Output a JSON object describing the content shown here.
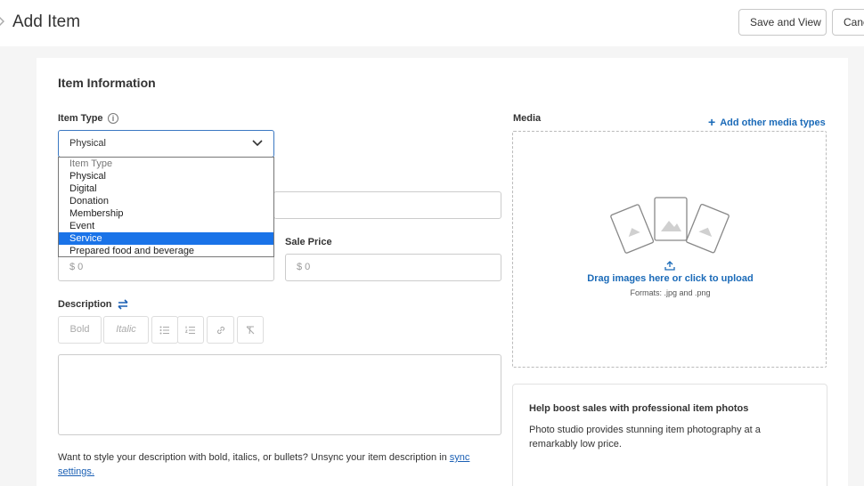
{
  "header": {
    "title": "Add Item",
    "save_view_label": "Save and View",
    "cancel_label": "Canc"
  },
  "item_info": {
    "section_title": "Item Information",
    "item_type_label": "Item Type",
    "item_type_value": "Physical",
    "options": [
      "Item Type",
      "Physical",
      "Digital",
      "Donation",
      "Membership",
      "Event",
      "Service",
      "Prepared food and beverage"
    ],
    "selected_option": "Service",
    "price_placeholder": "$  0",
    "sale_price_label": "Sale Price",
    "sale_price_placeholder": "$  0"
  },
  "description": {
    "label": "Description",
    "toolbar": {
      "bold": "Bold",
      "italic": "Italic"
    },
    "sync_text": "Want to style your description with bold, italics, or bullets? Unsync your item description in ",
    "sync_link": "sync settings."
  },
  "media": {
    "label": "Media",
    "add_link": "Add other media types",
    "upload_text": "Drag images here or click to upload",
    "formats": "Formats: .jpg and .png"
  },
  "boost": {
    "title": "Help boost sales with professional item photos",
    "text": "Photo studio provides stunning item photography at a remarkably low price."
  },
  "colors": {
    "accent": "#1a73e8",
    "link": "#1a6ab8"
  }
}
